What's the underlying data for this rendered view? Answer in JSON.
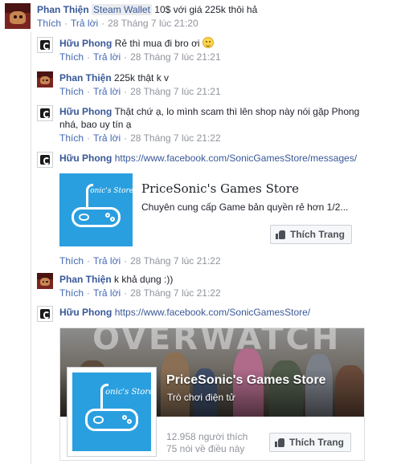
{
  "comments": [
    {
      "author": "Phan Thiện",
      "tag": "Steam Wallet",
      "text": "10$ với giá 225k thôi hả",
      "like": "Thích",
      "reply": "Trả lời",
      "time": "28 Tháng 7 lúc 21:20"
    },
    {
      "author": "Hữu Phong",
      "text": "Rẻ thì mua đi bro ơi",
      "emoji": "smile-emoji",
      "like": "Thích",
      "reply": "Trả lời",
      "time": "28 Tháng 7 lúc 21:21"
    },
    {
      "author": "Phan Thiện",
      "text": "225k thật k v",
      "like": "Thích",
      "reply": "Trả lời",
      "time": "28 Tháng 7 lúc 21:21"
    },
    {
      "author": "Hữu Phong",
      "text_line1": "Thật chứ ạ, lo mình scam thì lên shop này nói gặp Phong",
      "text_line2": "nhá, bao uy tín ạ",
      "like": "Thích",
      "reply": "Trả lời",
      "time": "28 Tháng 7 lúc 21:22"
    },
    {
      "author": "Hữu Phong",
      "link": "https://www.facebook.com/SonicGamesStore/messages/",
      "like": "Thích",
      "reply": "Trả lời",
      "time": "28 Tháng 7 lúc 21:22"
    },
    {
      "author": "Phan Thiện",
      "text": "k khả dụng :))",
      "like": "Thích",
      "reply": "Trả lời",
      "time": "28 Tháng 7 lúc 21:22"
    },
    {
      "author": "Hữu Phong",
      "link": "https://www.facebook.com/SonicGamesStore/"
    }
  ],
  "link_preview": {
    "title": "PriceSonic's Games Store",
    "description": "Chuyên cung cấp Game bản quyền rẻ hơn 1/2...",
    "logo_text": "onic's Store",
    "like_button": "Thích Trang"
  },
  "page_card": {
    "cover_text": "OVERWATCH",
    "title": "PriceSonic's Games Store",
    "category": "Trò chơi điện tử",
    "likes": "12.958 người thích",
    "talking": "75 nói về điều này",
    "logo_text": "onic's Store",
    "like_button": "Thích Trang"
  },
  "colors": {
    "link": "#385898",
    "action": "#4267b2",
    "meta": "#90949c",
    "logo_blue": "#2a9fdf"
  }
}
